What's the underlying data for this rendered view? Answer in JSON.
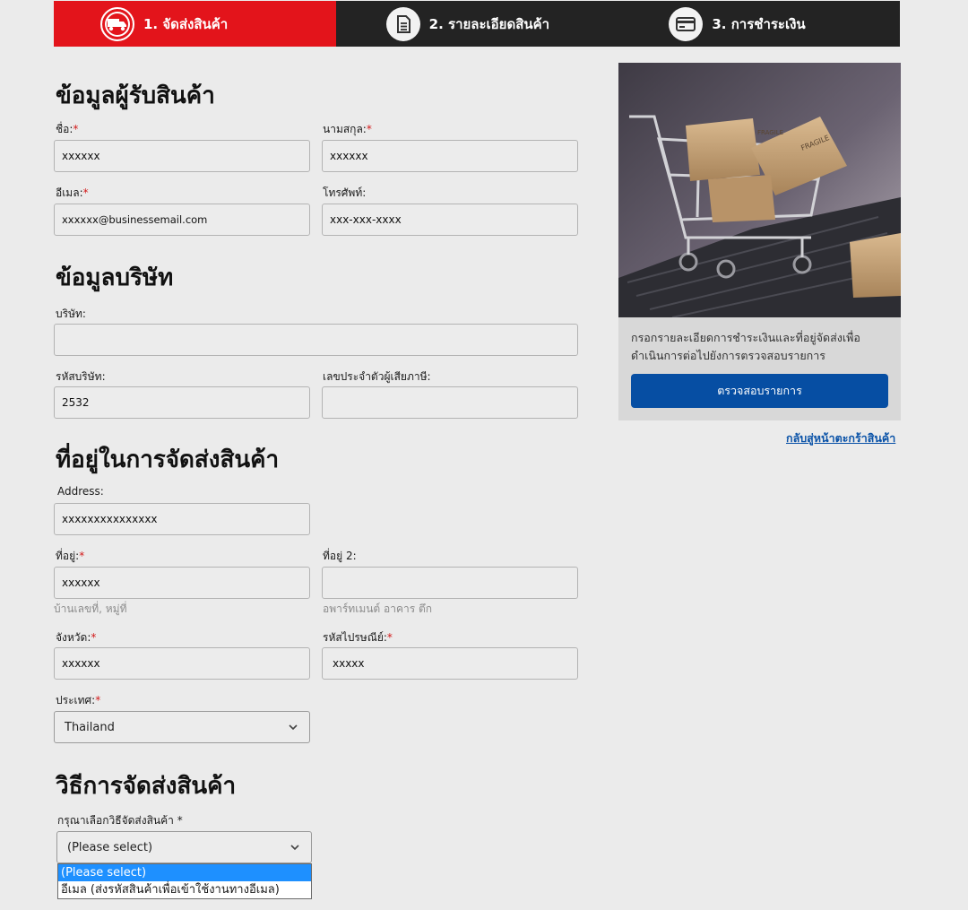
{
  "steps": [
    {
      "label": "1. จัดส่งสินค้า",
      "icon": "truck-icon",
      "active": true
    },
    {
      "label": "2. รายละเอียดสินค้า",
      "icon": "document-icon",
      "active": false
    },
    {
      "label": "3. การชำระเงิน",
      "icon": "credit-card-icon",
      "active": false
    }
  ],
  "recipient": {
    "title": "ข้อมูลผู้รับสินค้า",
    "first_name": {
      "label": "ชื่อ:",
      "value": "xxxxxx"
    },
    "last_name": {
      "label": "นามสกุล:",
      "value": "xxxxxx"
    },
    "email": {
      "label": "อีเมล:",
      "value": "xxxxxx@businessemail.com"
    },
    "phone": {
      "label": "โทรศัพท์:",
      "value": "xxx-xxx-xxxx"
    }
  },
  "company": {
    "title": "ข้อมูลบริษัท",
    "company_name": {
      "label": "บริษัท:",
      "value": ""
    },
    "company_code": {
      "label": "รหัสบริษัท:",
      "value": "2532"
    },
    "tax_id": {
      "label": "เลขประจำตัวผู้เสียภาษี:",
      "value": ""
    }
  },
  "shipping_address": {
    "title": "ที่อยู่ในการจัดส่งสินค้า",
    "address": {
      "label": "Address:",
      "value": "xxxxxxxxxxxxxxx"
    },
    "address1": {
      "label": "ที่อยู่:",
      "value": "xxxxxx",
      "hint": "บ้านเลขที่, หมู่ที่"
    },
    "address2": {
      "label": "ที่อยู่ 2:",
      "value": "",
      "hint": "อพาร์ทเมนต์ อาคาร ตึก"
    },
    "province": {
      "label": "จังหวัด:",
      "value": "xxxxxx"
    },
    "postcode": {
      "label": "รหัสไปรษณีย์:",
      "value": "xxxxx"
    },
    "country": {
      "label": "ประเทศ:",
      "value": "Thailand"
    }
  },
  "shipping_method": {
    "title": "วิธีการจัดส่งสินค้า",
    "label": "กรุณาเลือกวิธีจัดส่งสินค้า *",
    "value": "(Please select)",
    "options": [
      "(Please select)",
      "อีเมล (ส่งรหัสสินค้าเพื่อเข้าใช้งานทางอีเมล)"
    ]
  },
  "required_mark": "*",
  "sidebar": {
    "text": "กรอกรายละเอียดการชำระเงินและที่อยู่จัดส่งเพื่อดำเนินการต่อไปยังการตรวจสอบรายการ",
    "button": "ตรวจสอบรายการ",
    "back_link": "กลับสู่หน้าตะกร้าสินค้า",
    "image_label_1": "FRAGILE",
    "image_label_2": "FRAGILE"
  },
  "colors": {
    "active_step": "#e3141b",
    "step_bar": "#232323",
    "primary_button": "#064ea3",
    "link": "#0b53a8",
    "required": "#d31a1a"
  }
}
